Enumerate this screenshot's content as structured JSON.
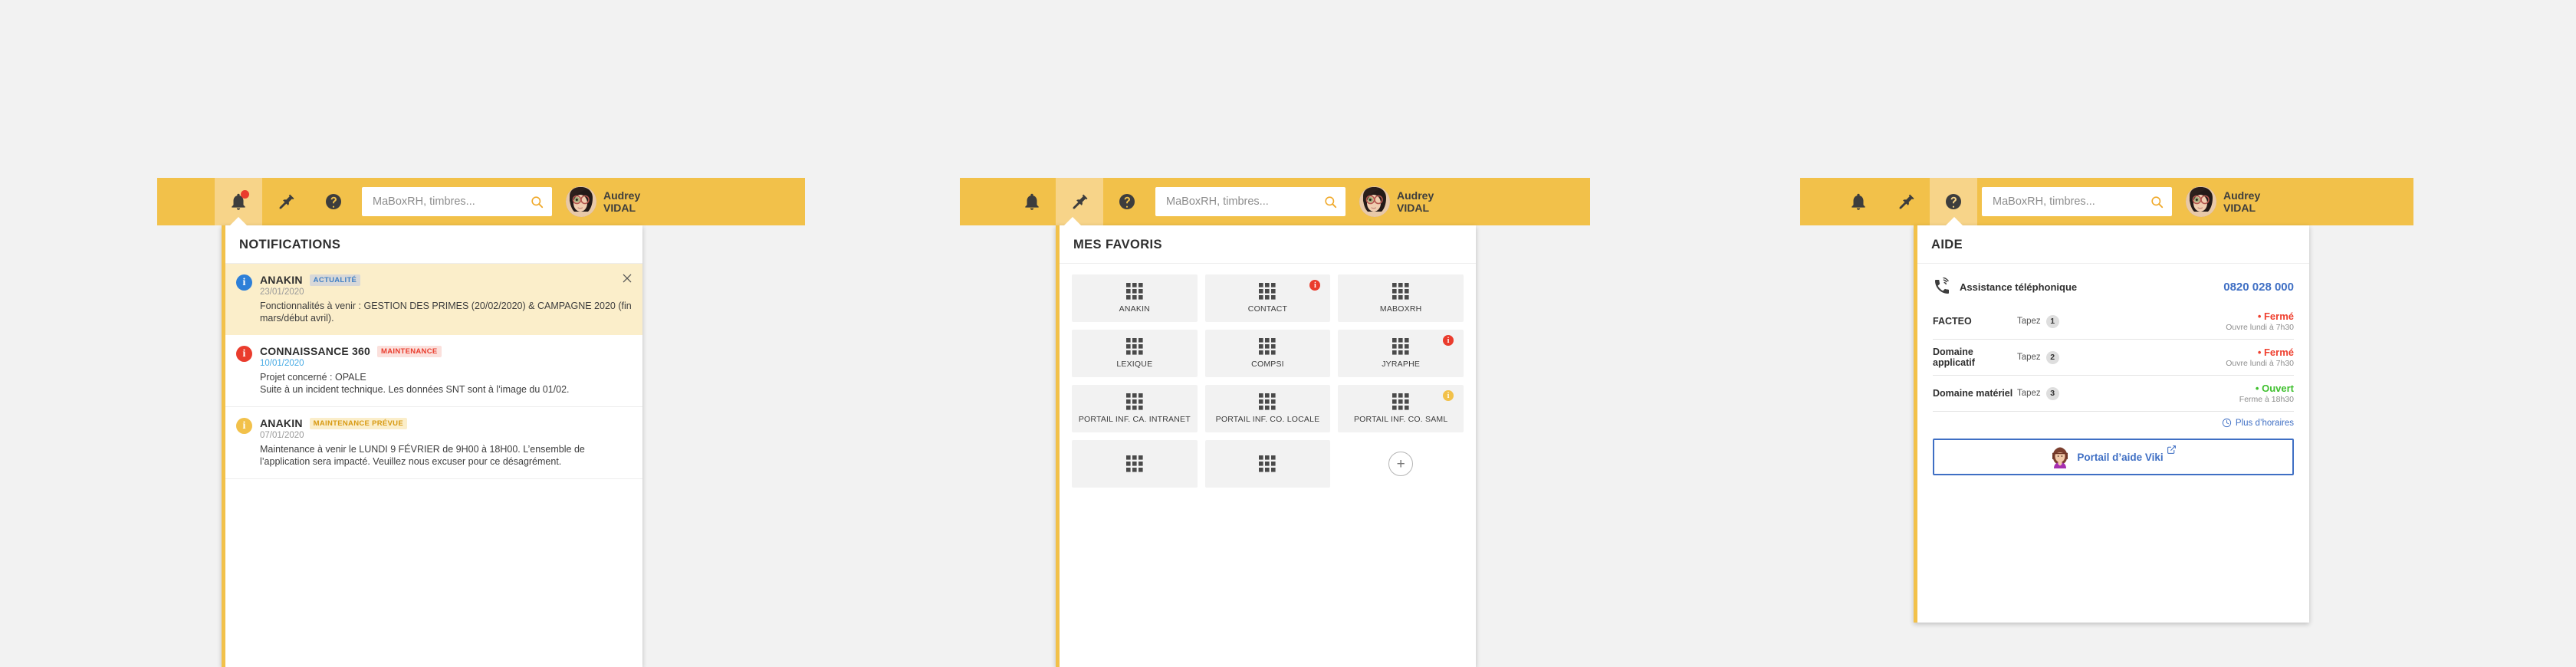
{
  "header": {
    "search_placeholder": "MaBoxRH, timbres...",
    "user_first_name": "Audrey",
    "user_last_name": "VIDAL",
    "icons": {
      "bell": "bell-icon",
      "pin": "pin-icon",
      "help": "help-icon",
      "search": "search-icon"
    },
    "accent_color": "#f2c14a",
    "accent_active_color": "#f7d489"
  },
  "notifications_panel": {
    "title": "NOTIFICATIONS",
    "close_label": "×",
    "items": [
      {
        "app": "ANAKIN",
        "tag": "ACTUALITÉ",
        "tag_style": "actualite",
        "icon_style": "blue",
        "date": "23/01/2020",
        "date_style": "grey",
        "text": "Fonctionnalités à venir : GESTION DES PRIMES (20/02/2020) & CAMPAGNE 2020 (fin mars/début avril).",
        "highlight": true,
        "closable": true
      },
      {
        "app": "CONNAISSANCE 360",
        "tag": "MAINTENANCE",
        "tag_style": "maintenance",
        "icon_style": "red",
        "date": "10/01/2020",
        "date_style": "blue",
        "text": "Projet concerné : OPALE\nSuite à un incident technique. Les données SNT sont à l’image du 01/02.",
        "highlight": false,
        "closable": false
      },
      {
        "app": "ANAKIN",
        "tag": "MAINTENANCE PRÉVUE",
        "tag_style": "prevue",
        "icon_style": "amber",
        "date": "07/01/2020",
        "date_style": "grey",
        "text": "Maintenance à venir le LUNDI 9 FÉVRIER de 9H00 à 18H00. L’ensemble de l’application sera impacté. Veuillez nous excuser pour ce désagrément.",
        "highlight": false,
        "closable": false
      }
    ]
  },
  "favorites_panel": {
    "title": "MES FAVORIS",
    "add_label": "+",
    "tiles": [
      {
        "label": "ANAKIN",
        "badge": null
      },
      {
        "label": "CONTACT",
        "badge": "red"
      },
      {
        "label": "MABOXRH",
        "badge": null
      },
      {
        "label": "LEXIQUE",
        "badge": null
      },
      {
        "label": "COMPSI",
        "badge": null
      },
      {
        "label": "JYRAPHE",
        "badge": "red"
      },
      {
        "label": "PORTAIL INF. CA. INTRANET",
        "badge": null
      },
      {
        "label": "PORTAIL INF. CO. LOCALE",
        "badge": null
      },
      {
        "label": "PORTAIL INF. CO. SAML",
        "badge": "amber"
      },
      {
        "label": "",
        "badge": null
      },
      {
        "label": "",
        "badge": null
      }
    ]
  },
  "help_panel": {
    "title": "AIDE",
    "phone_label": "Assistance téléphonique",
    "phone_number": "0820 028 000",
    "tapez_label": "Tapez",
    "rows": [
      {
        "name": "FACTEO",
        "key": "1",
        "state": "• Fermé",
        "state_style": "closed",
        "sub": "Ouvre lundi à 7h30"
      },
      {
        "name": "Domaine applicatif",
        "key": "2",
        "state": "• Fermé",
        "state_style": "closed",
        "sub": "Ouvre lundi à 7h30"
      },
      {
        "name": "Domaine matériel",
        "key": "3",
        "state": "• Ouvert",
        "state_style": "open",
        "sub": "Ferme à 18h30"
      }
    ],
    "more_hours_label": "Plus d’horaires",
    "viki_label": "Portail d’aide Viki"
  }
}
